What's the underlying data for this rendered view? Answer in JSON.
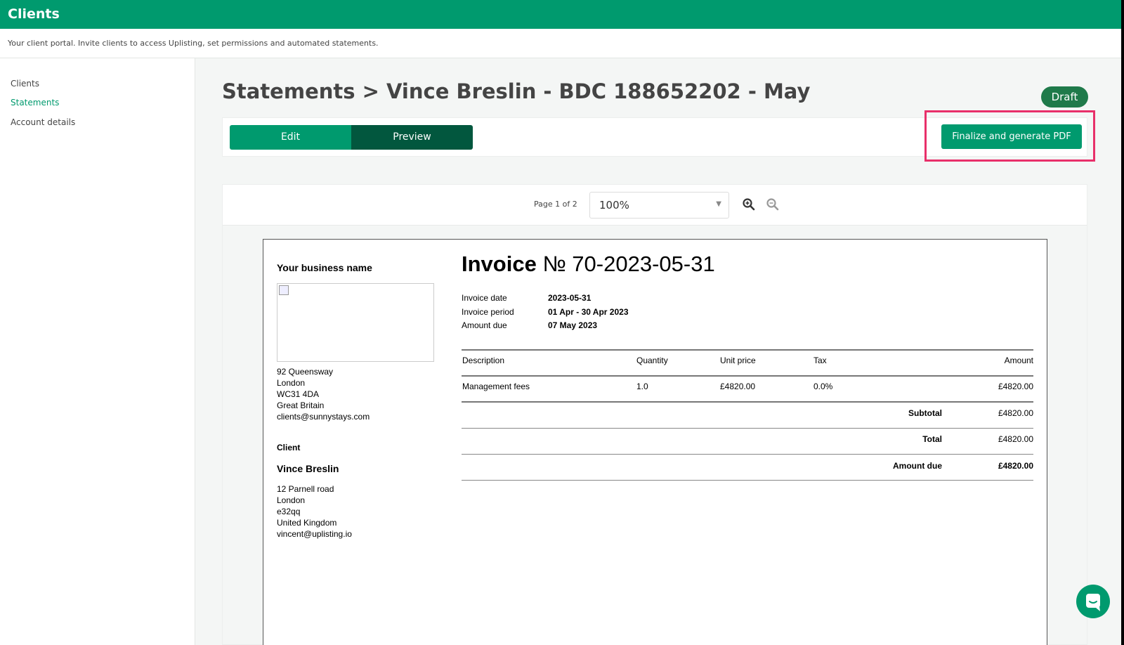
{
  "header": {
    "title": "Clients",
    "subtitle": "Your client portal. Invite clients to access Uplisting, set permissions and automated statements."
  },
  "sidebar": {
    "items": [
      {
        "label": "Clients",
        "active": false
      },
      {
        "label": "Statements",
        "active": true
      },
      {
        "label": "Account details",
        "active": false
      }
    ]
  },
  "page": {
    "title": "Statements > Vince Breslin - BDC 188652202 - May",
    "status": "Draft",
    "tabs": {
      "edit": "Edit",
      "preview": "Preview"
    },
    "finalize_label": "Finalize and generate PDF"
  },
  "viewer": {
    "page_info": "Page 1 of 2",
    "zoom": "100%",
    "zoom_in_icon": "zoom-in-icon",
    "zoom_out_icon": "zoom-out-icon"
  },
  "invoice": {
    "business_name": "Your business name",
    "business_address": [
      "92 Queensway",
      "London",
      "WC31 4DA",
      "Great Britain",
      "clients@sunnystays.com"
    ],
    "client_heading": "Client",
    "client_name": "Vince Breslin",
    "client_address": [
      "12 Parnell road",
      "London",
      "e32qq",
      "United Kingdom",
      "vincent@uplisting.io"
    ],
    "title_bold": "Invoice",
    "title_number": " № 70-2023-05-31",
    "meta": [
      {
        "label": "Invoice date",
        "value": "2023-05-31"
      },
      {
        "label": "Invoice period",
        "value": "01 Apr - 30 Apr 2023"
      },
      {
        "label": "Amount due",
        "value": "07 May 2023"
      }
    ],
    "columns": {
      "description": "Description",
      "quantity": "Quantity",
      "unit_price": "Unit price",
      "tax": "Tax",
      "amount": "Amount"
    },
    "rows": [
      {
        "description": "Management fees",
        "quantity": "1.0",
        "unit_price": "£4820.00",
        "tax": "0.0%",
        "amount": "£4820.00"
      }
    ],
    "subtotal_label": "Subtotal",
    "subtotal": "£4820.00",
    "total_label": "Total",
    "total": "£4820.00",
    "amount_due_label": "Amount due",
    "amount_due": "£4820.00"
  },
  "colors": {
    "brand": "#009a6e",
    "brand_dark": "#02573e",
    "draft_badge": "#1f7a4a",
    "highlight": "#e8306a"
  }
}
